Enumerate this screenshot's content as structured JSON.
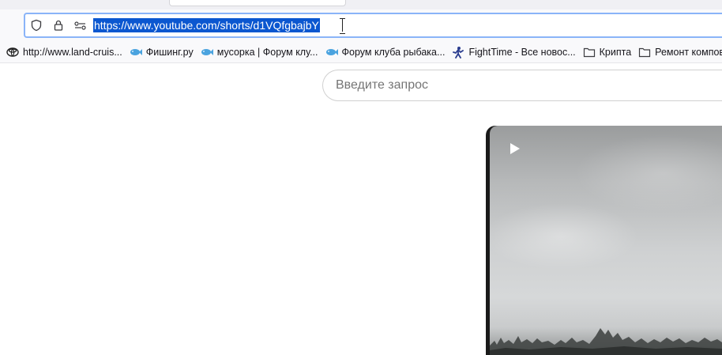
{
  "browser": {
    "address_bar": {
      "url": "https://www.youtube.com/shorts/d1VQfgbajbY",
      "icons": [
        "shield-icon",
        "lock-icon",
        "permissions-icon"
      ]
    },
    "bookmarks": [
      {
        "label": "http://www.land-cruis...",
        "icon": "toyota-logo-icon"
      },
      {
        "label": "Фишинг.ру",
        "icon": "fish-icon"
      },
      {
        "label": "мусорка | Форум клу...",
        "icon": "fish-icon"
      },
      {
        "label": "Форум клуба рыбака...",
        "icon": "fish-icon"
      },
      {
        "label": "FightTime - Все новос...",
        "icon": "fighter-icon"
      },
      {
        "label": "Крипта",
        "icon": "folder-icon"
      },
      {
        "label": "Ремонт компов",
        "icon": "folder-icon"
      }
    ],
    "colors": {
      "selection": "#0b57d0",
      "focus_ring": "#8ab4f8",
      "fish_icon": "#4aa3df"
    }
  },
  "page": {
    "search": {
      "placeholder": "Введите запрос"
    },
    "video": {
      "play_icon": "play-icon"
    }
  }
}
